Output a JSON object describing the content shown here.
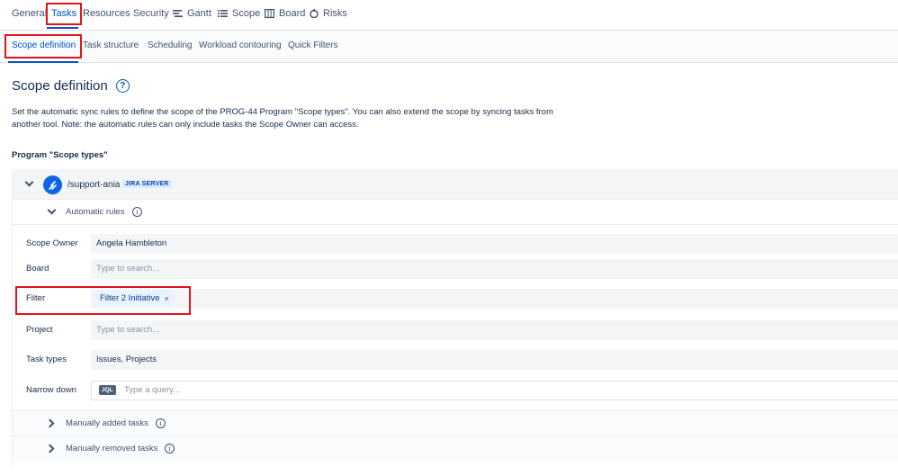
{
  "top_tabs": [
    {
      "label": "General",
      "icon": ""
    },
    {
      "label": "Tasks",
      "icon": ""
    },
    {
      "label": "Resources",
      "icon": ""
    },
    {
      "label": "Security",
      "icon": ""
    },
    {
      "label": "Gantt",
      "icon": "gantt-icon"
    },
    {
      "label": "Scope",
      "icon": "list-icon"
    },
    {
      "label": "Board",
      "icon": "board-icon"
    },
    {
      "label": "Risks",
      "icon": "risk-icon"
    }
  ],
  "sub_tabs": [
    {
      "label": "Scope definition"
    },
    {
      "label": "Task structure"
    },
    {
      "label": "Scheduling"
    },
    {
      "label": "Workload contouring"
    },
    {
      "label": "Quick Filters"
    }
  ],
  "page": {
    "title": "Scope definition",
    "help_glyph": "?",
    "description": "Set the automatic sync rules to define the scope of the PROG-44 Program \"Scope types\". You can also extend the scope by syncing tasks from another tool. Note: the automatic rules can only include tasks the Scope Owner can access.",
    "section_title": "Program \"Scope types\""
  },
  "source": {
    "name": "/support-ania",
    "badge": "JIRA SERVER"
  },
  "automatic_rules": {
    "label": "Automatic rules",
    "info_glyph": "i",
    "fields": {
      "scope_owner": {
        "label": "Scope Owner",
        "value": "Angela Hambleton"
      },
      "board": {
        "label": "Board",
        "placeholder": "Type to search..."
      },
      "filter": {
        "label": "Filter",
        "tag": "Filter 2 Initiative",
        "remove_glyph": "×"
      },
      "project": {
        "label": "Project",
        "placeholder": "Type to search..."
      },
      "task_types": {
        "label": "Task types",
        "value": "Issues, Projects"
      },
      "narrow_down": {
        "label": "Narrow down",
        "badge": "JQL",
        "placeholder": "Type a query..."
      }
    }
  },
  "collapsed_sections": {
    "manually_added": {
      "label": "Manually added tasks",
      "info_glyph": "i"
    },
    "manually_removed": {
      "label": "Manually removed tasks",
      "info_glyph": "i"
    }
  },
  "colors": {
    "accent": "#0052cc",
    "highlight_box": "#e5121b",
    "jira_logo": "#0c66e4"
  }
}
